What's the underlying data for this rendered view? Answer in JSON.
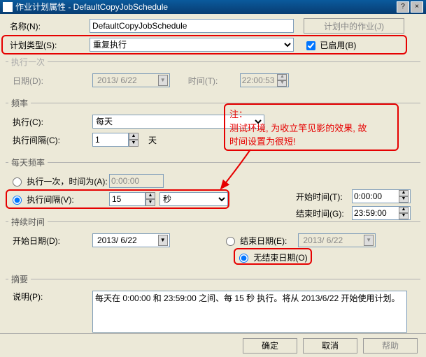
{
  "title": "作业计划属性 - DefaultCopyJobSchedule",
  "name_label": "名称(N):",
  "name_value": "DefaultCopyJobSchedule",
  "jobs_in_schedule_btn": "计划中的作业(J)",
  "schedule_type_label": "计划类型(S):",
  "schedule_type_value": "重复执行",
  "enabled_label": "已启用(B)",
  "once_section": "执行一次",
  "once_date_label": "日期(D):",
  "once_date_value": "2013/ 6/22",
  "once_time_label": "时间(T):",
  "once_time_value": "22:00:53",
  "freq_section": "频率",
  "freq_exec_label": "执行(C):",
  "freq_exec_value": "每天",
  "freq_interval_label": "执行间隔(C):",
  "freq_interval_value": "1",
  "freq_interval_unit": "天",
  "daily_section": "每天频率",
  "daily_once_label": "执行一次，时间为(A):",
  "daily_once_value": "0:00:00",
  "daily_interval_label": "执行间隔(V):",
  "daily_interval_value": "15",
  "daily_interval_unit": "秒",
  "daily_start_label": "开始时间(T):",
  "daily_start_value": "0:00:00",
  "daily_end_label": "结束时间(G):",
  "daily_end_value": "23:59:00",
  "duration_section": "持续时间",
  "start_date_label": "开始日期(D):",
  "start_date_value": "2013/ 6/22",
  "end_date_label": "结束日期(E):",
  "end_date_value": "2013/ 6/22",
  "no_end_date_label": "无结束日期(O)",
  "summary_section": "摘要",
  "summary_label": "说明(P):",
  "summary_text": "每天在 0:00:00 和 23:59:00 之间、每 15 秒 执行。将从 2013/6/22 开始使用计划。",
  "ok_btn": "确定",
  "cancel_btn": "取消",
  "help_btn": "帮助",
  "annotation_title": "注：",
  "annotation_body1": "  测试环境, 为收立竿见影的效果, 故",
  "annotation_body2": "时间设置为很短!"
}
